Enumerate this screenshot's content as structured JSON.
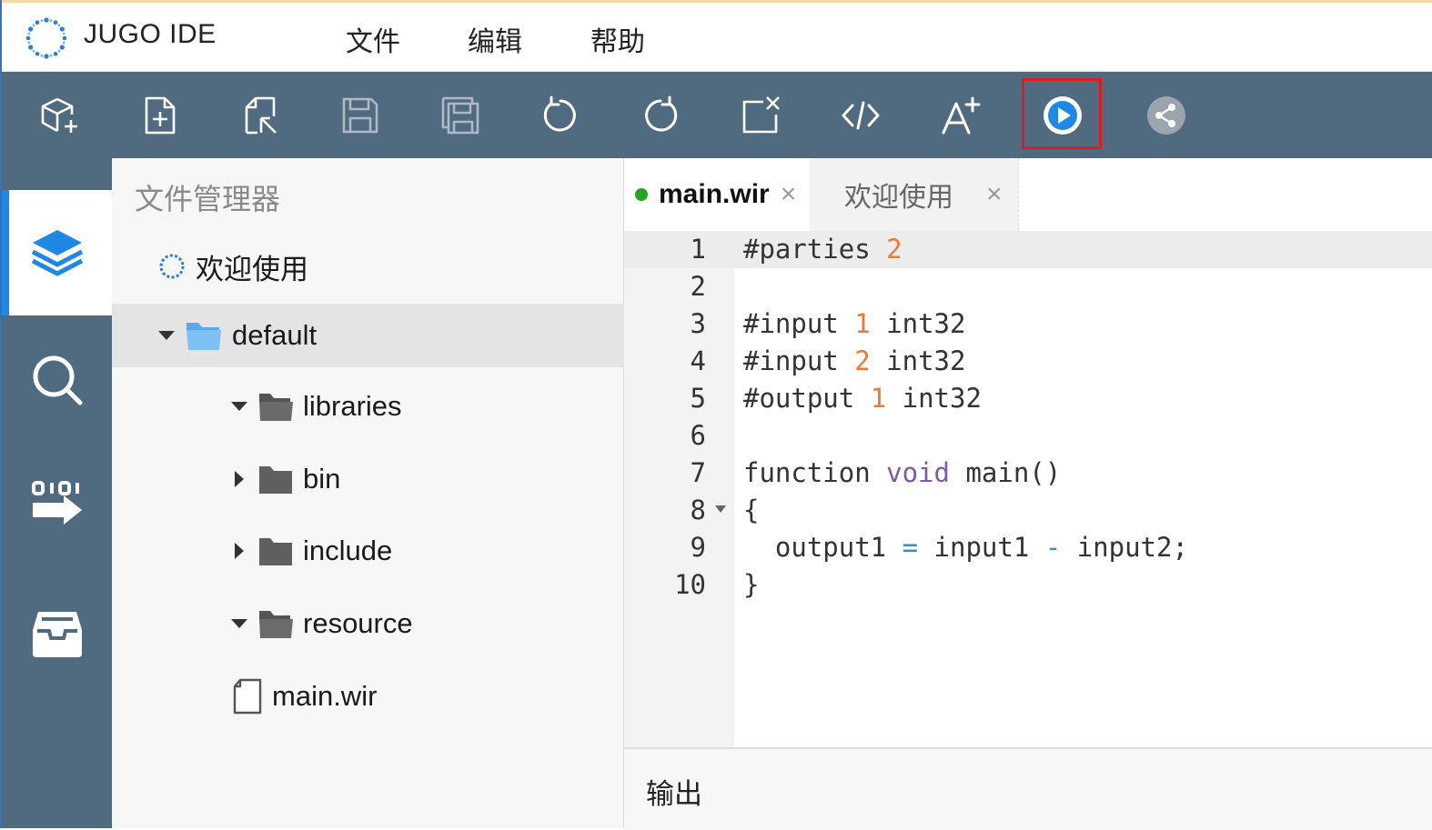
{
  "app": {
    "title": "JUGO IDE",
    "menu": [
      "文件",
      "编辑",
      "帮助"
    ]
  },
  "toolbar": {
    "buttons": [
      {
        "icon": "new-project-icon"
      },
      {
        "icon": "new-file-icon"
      },
      {
        "icon": "open-file-icon"
      },
      {
        "icon": "save-icon"
      },
      {
        "icon": "save-all-icon"
      },
      {
        "icon": "undo-icon"
      },
      {
        "icon": "redo-icon"
      },
      {
        "icon": "close-file-icon"
      },
      {
        "icon": "code-icon"
      },
      {
        "icon": "font-size-increase-icon"
      },
      {
        "icon": "run-icon",
        "highlighted": true
      },
      {
        "icon": "share-icon"
      }
    ],
    "colors": {
      "background": "#506a80",
      "run": "#1e88e5",
      "highlight": "#e21b1b"
    }
  },
  "activity_bar": {
    "items": [
      {
        "icon": "layers-icon",
        "active": true
      },
      {
        "icon": "search-icon",
        "active": false
      },
      {
        "icon": "binary-transfer-icon",
        "active": false
      },
      {
        "icon": "inbox-icon",
        "active": false
      }
    ]
  },
  "explorer": {
    "title": "文件管理器",
    "items": [
      {
        "label": "欢迎使用",
        "type": "welcome",
        "depth": 0
      },
      {
        "label": "default",
        "type": "folder",
        "expanded": true,
        "selected": true,
        "depth": 0
      },
      {
        "label": "libraries",
        "type": "folder",
        "expanded": true,
        "depth": 1
      },
      {
        "label": "bin",
        "type": "folder",
        "expanded": false,
        "depth": 1
      },
      {
        "label": "include",
        "type": "folder",
        "expanded": false,
        "depth": 1
      },
      {
        "label": "resource",
        "type": "folder",
        "expanded": true,
        "depth": 1
      },
      {
        "label": "main.wir",
        "type": "file",
        "depth": 1
      }
    ]
  },
  "editor": {
    "tabs": [
      {
        "label": "main.wir",
        "active": true,
        "modified": true,
        "close": "×"
      },
      {
        "label": "欢迎使用",
        "active": false,
        "close": "×"
      }
    ],
    "current_line": 1,
    "folded_line": 8,
    "lines": [
      {
        "n": "1",
        "tokens": [
          {
            "t": "#parties "
          },
          {
            "t": "2",
            "c": "num"
          }
        ]
      },
      {
        "n": "2",
        "tokens": []
      },
      {
        "n": "3",
        "tokens": [
          {
            "t": "#input "
          },
          {
            "t": "1",
            "c": "num"
          },
          {
            "t": " int32"
          }
        ]
      },
      {
        "n": "4",
        "tokens": [
          {
            "t": "#input "
          },
          {
            "t": "2",
            "c": "num"
          },
          {
            "t": " int32"
          }
        ]
      },
      {
        "n": "5",
        "tokens": [
          {
            "t": "#output "
          },
          {
            "t": "1",
            "c": "num"
          },
          {
            "t": " int32"
          }
        ]
      },
      {
        "n": "6",
        "tokens": []
      },
      {
        "n": "7",
        "tokens": [
          {
            "t": "function "
          },
          {
            "t": "void",
            "c": "kw"
          },
          {
            "t": " main()"
          }
        ]
      },
      {
        "n": "8",
        "tokens": [
          {
            "t": "{"
          }
        ]
      },
      {
        "n": "9",
        "tokens": [
          {
            "t": "  output1 "
          },
          {
            "t": "=",
            "c": "op"
          },
          {
            "t": " input1 "
          },
          {
            "t": "-",
            "c": "op"
          },
          {
            "t": " input2;"
          }
        ]
      },
      {
        "n": "10",
        "tokens": [
          {
            "t": "}"
          }
        ]
      }
    ]
  },
  "output": {
    "title": "输出"
  }
}
